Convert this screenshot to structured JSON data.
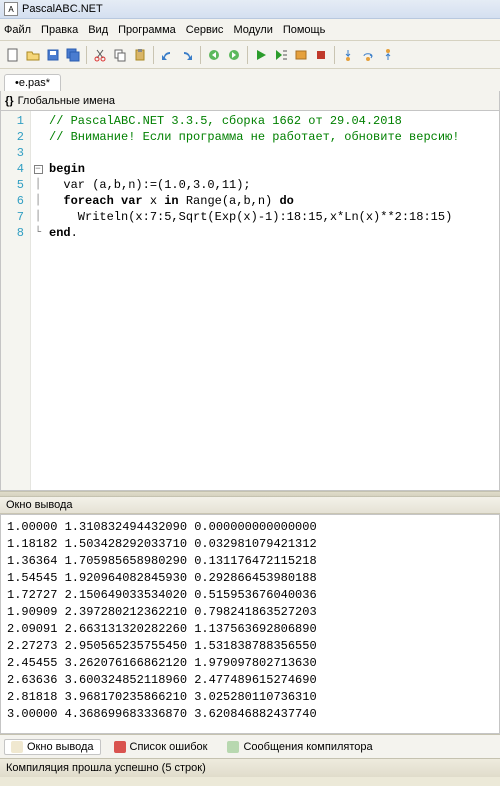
{
  "title": "PascalABC.NET",
  "menu": {
    "file": "Файл",
    "edit": "Правка",
    "view": "Вид",
    "program": "Программа",
    "service": "Сервис",
    "modules": "Модули",
    "help": "Помощь"
  },
  "tab": "•e.pas*",
  "scope": "Глобальные имена",
  "code": {
    "lines": [
      "1",
      "2",
      "3",
      "4",
      "5",
      "6",
      "7",
      "8"
    ],
    "l1": "// PascalABC.NET 3.3.5, сборка 1662 от 29.04.2018",
    "l2": "// Внимание! Если программа не работает, обновите версию!",
    "l4a": "begin",
    "l5": "  var (a,b,n):=(1.0,3.0,11);",
    "l6a": "  foreach var",
    "l6b": " x ",
    "l6c": "in",
    "l6d": " Range(a,b,n) ",
    "l6e": "do",
    "l7": "    Writeln(x:7:5,Sqrt(Exp(x)-1):18:15,x*Ln(x)**2:18:15)",
    "l8a": "end",
    "l8b": "."
  },
  "output_title": "Окно вывода",
  "output_rows": [
    "1.00000 1.310832494432090 0.000000000000000",
    "1.18182 1.503428292033710 0.032981079421312",
    "1.36364 1.705985658980290 0.131176472115218",
    "1.54545 1.920964082845930 0.292866453980188",
    "1.72727 2.150649033534020 0.515953676040036",
    "1.90909 2.397280212362210 0.798241863527203",
    "2.09091 2.663131320282260 1.137563692806890",
    "2.27273 2.950565235755450 1.531838788356550",
    "2.45455 3.262076166862120 1.979097802713630",
    "2.63636 3.600324852118960 2.477489615274690",
    "2.81818 3.968170235866210 3.025280110736310",
    "3.00000 4.368699683336870 3.620846882437740"
  ],
  "bottom_tabs": {
    "output": "Окно вывода",
    "errors": "Список ошибок",
    "compiler": "Сообщения компилятора"
  },
  "status": "Компиляция прошла успешно (5 строк)"
}
